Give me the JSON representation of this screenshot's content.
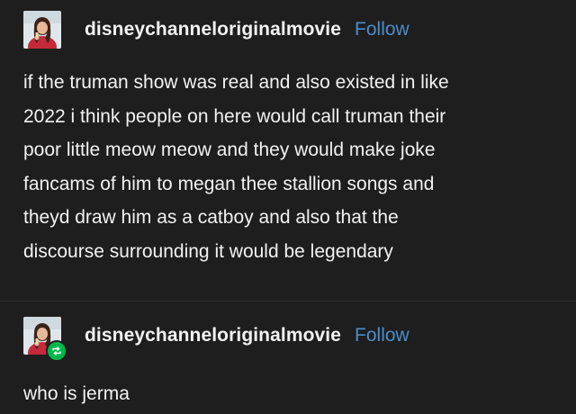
{
  "posts": [
    {
      "username": "disneychanneloriginalmovie",
      "follow_label": "Follow",
      "avatar_icon": "profile-avatar",
      "lines": [
        "if the truman show was real and also existed in like",
        "2022 i think people on here would call truman their",
        "poor little meow meow and they would make joke",
        "fancams of him to megan thee stallion songs and",
        "theyd draw him as a catboy and also that the",
        "discourse surrounding it would be legendary"
      ]
    },
    {
      "username": "disneychanneloriginalmovie",
      "follow_label": "Follow",
      "avatar_icon": "profile-avatar",
      "badge_icon": "reblog-icon",
      "badge_color": "#00b84a",
      "text": "who is jerma"
    }
  ],
  "colors": {
    "background": "#1e1e1e",
    "text": "#f2f2f2",
    "follow": "#4b8dc9"
  }
}
